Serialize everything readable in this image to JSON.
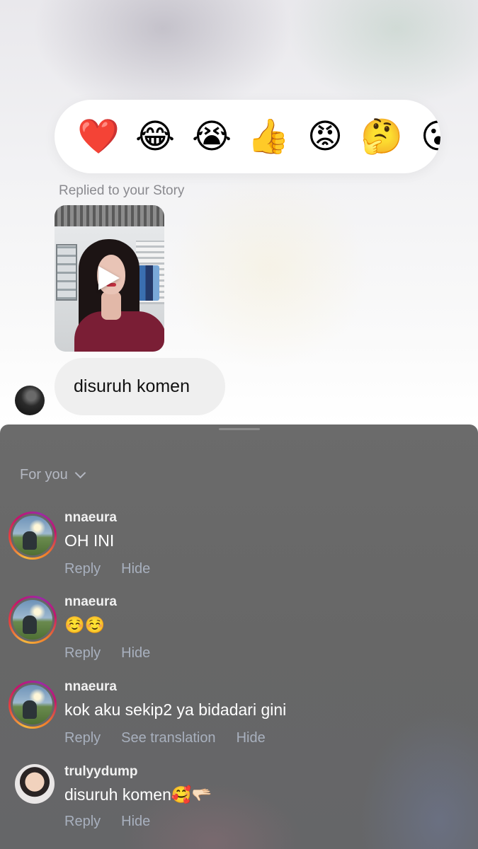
{
  "reactions": [
    {
      "name": "heart",
      "glyph": "❤️"
    },
    {
      "name": "laughing",
      "glyph": "😂"
    },
    {
      "name": "crying",
      "glyph": "😭"
    },
    {
      "name": "thumbs-up",
      "glyph": "👍"
    },
    {
      "name": "angry",
      "glyph": "😡"
    },
    {
      "name": "thinking",
      "glyph": "🤔"
    },
    {
      "name": "surprised",
      "glyph": "😮"
    }
  ],
  "dm": {
    "replied_label": "Replied to your Story",
    "message": "disuruh komen"
  },
  "comments_sheet": {
    "filter_label": "For you",
    "comments": [
      {
        "username": "nnaeura",
        "text": "OH INI",
        "reply": "Reply",
        "see_translation": "",
        "hide": "Hide"
      },
      {
        "username": "nnaeura",
        "text": "☺️☺️",
        "reply": "Reply",
        "see_translation": "",
        "hide": "Hide"
      },
      {
        "username": "nnaeura",
        "text": "kok aku sekip2 ya bidadari gini",
        "reply": "Reply",
        "see_translation": "See translation",
        "hide": "Hide"
      },
      {
        "username": "trulyydump",
        "text": "disuruh komen🥰🫳🏻",
        "reply": "Reply",
        "see_translation": "",
        "hide": "Hide"
      }
    ]
  },
  "colors": {
    "sheet_bg": "#676767",
    "action_text": "#a8b0be",
    "bubble_bg": "#efefef"
  }
}
